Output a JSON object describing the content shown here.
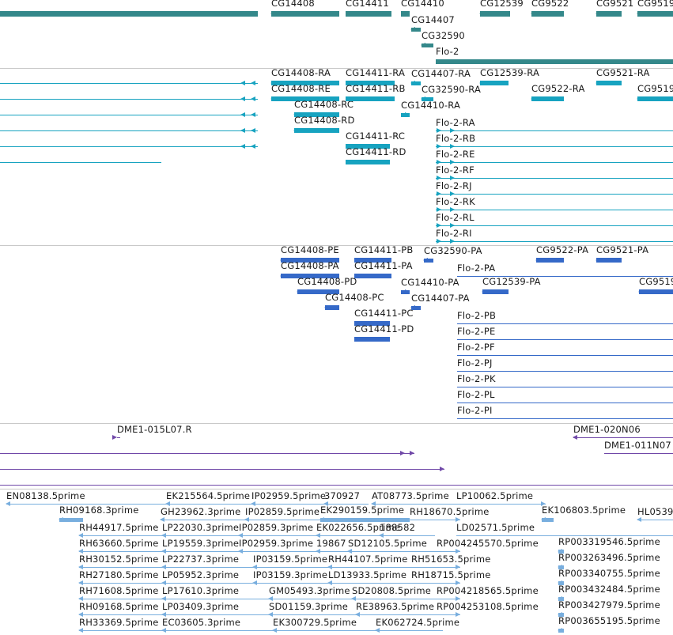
{
  "colors": {
    "gene": "#34888a",
    "transcript": "#17a3c0",
    "protein": "#3569c8",
    "clone": "#7048a8",
    "est": "#78aede",
    "separator": "#c9c9c9"
  },
  "tracks": [
    {
      "name": "gene",
      "color": "gene",
      "items": [
        [
          "",
          -20,
          326,
          17,
          7,
          "r"
        ],
        [
          "CG14408",
          343,
          429,
          17,
          7,
          "l"
        ],
        [
          "CG14411",
          437,
          495,
          17,
          7,
          "r"
        ],
        [
          "CG14410",
          507,
          518,
          17,
          7,
          "r"
        ],
        [
          "CG14407",
          520,
          532,
          37,
          5,
          "l"
        ],
        [
          "CG32590",
          533,
          548,
          57,
          5,
          "l"
        ],
        [
          "Flo-2",
          551,
          860,
          78,
          6,
          "r"
        ],
        [
          "CG12539",
          607,
          645,
          17,
          7,
          "l"
        ],
        [
          "CG9522",
          672,
          713,
          17,
          7,
          "l"
        ],
        [
          "CG9521",
          754,
          786,
          17,
          7,
          "l"
        ],
        [
          "CG9519",
          806,
          860,
          17,
          7,
          "l"
        ]
      ]
    },
    {
      "name": "transcript",
      "color": "transcript",
      "items": [
        [
          "",
          -20,
          326,
          105,
          1,
          "l",
          [
            318,
            305
          ]
        ],
        [
          "",
          -20,
          326,
          125,
          1,
          "l",
          [
            318,
            305
          ]
        ],
        [
          "",
          -20,
          326,
          145,
          1,
          "l",
          [
            318,
            305
          ]
        ],
        [
          "",
          -20,
          326,
          165,
          1,
          "l",
          [
            318,
            305
          ]
        ],
        [
          "",
          -20,
          326,
          185,
          1,
          "l",
          [
            318,
            305
          ]
        ],
        [
          "",
          -20,
          204,
          205,
          1,
          "l"
        ],
        [
          "CG14408-RA",
          343,
          429,
          105,
          6,
          "l"
        ],
        [
          "CG14408-RE",
          343,
          429,
          125,
          6,
          "l"
        ],
        [
          "CG14408-RC",
          372,
          429,
          145,
          6,
          "l"
        ],
        [
          "CG14408-RD",
          372,
          429,
          165,
          6,
          "l"
        ],
        [
          "CG14411-RA",
          437,
          499,
          105,
          6,
          "r"
        ],
        [
          "CG14411-RB",
          437,
          499,
          125,
          6,
          "r"
        ],
        [
          "CG14411-RC",
          437,
          493,
          185,
          6,
          "r"
        ],
        [
          "CG14411-RD",
          437,
          493,
          205,
          6,
          "r"
        ],
        [
          "CG14407-RA",
          520,
          532,
          105,
          5,
          "l"
        ],
        [
          "CG32590-RA",
          533,
          548,
          125,
          5,
          "l"
        ],
        [
          "CG14410-RA",
          507,
          518,
          145,
          5,
          "r"
        ],
        [
          "CG12539-RA",
          607,
          643,
          105,
          6,
          "l"
        ],
        [
          "CG9522-RA",
          672,
          713,
          125,
          6,
          "l"
        ],
        [
          "CG9521-RA",
          754,
          786,
          105,
          6,
          "l"
        ],
        [
          "CG9519",
          806,
          860,
          125,
          6,
          "l"
        ],
        [
          "Flo-2-RA",
          551,
          860,
          165,
          1,
          "r",
          [
            558,
            575
          ]
        ],
        [
          "Flo-2-RB",
          551,
          860,
          185,
          1,
          "r",
          [
            558,
            575
          ]
        ],
        [
          "Flo-2-RE",
          551,
          860,
          205,
          1,
          "r",
          [
            558,
            575
          ]
        ],
        [
          "Flo-2-RF",
          551,
          860,
          225,
          1,
          "r",
          [
            558,
            575
          ]
        ],
        [
          "Flo-2-RJ",
          551,
          860,
          245,
          1,
          "r",
          [
            558,
            575
          ]
        ],
        [
          "Flo-2-RK",
          551,
          860,
          265,
          1,
          "r",
          [
            558,
            575
          ]
        ],
        [
          "Flo-2-RL",
          551,
          860,
          285,
          1,
          "r",
          [
            558,
            575
          ]
        ],
        [
          "Flo-2-RI",
          551,
          860,
          305,
          1,
          "r",
          [
            558,
            575
          ]
        ]
      ]
    },
    {
      "name": "protein",
      "color": "protein",
      "items": [
        [
          "CG14408-PE",
          355,
          429,
          329,
          6,
          "l"
        ],
        [
          "CG14408-PA",
          355,
          429,
          349,
          6,
          "l"
        ],
        [
          "CG14408-PD",
          376,
          429,
          369,
          6,
          "l"
        ],
        [
          "CG14408-PC",
          411,
          429,
          389,
          6,
          "l"
        ],
        [
          "CG14411-PB",
          448,
          495,
          329,
          6,
          "r"
        ],
        [
          "CG14411-PA",
          448,
          495,
          349,
          6,
          "r"
        ],
        [
          "CG14411-PC",
          448,
          493,
          409,
          6,
          "r"
        ],
        [
          "CG14411-PD",
          448,
          493,
          429,
          6,
          "r"
        ],
        [
          "CG32590-PA",
          536,
          548,
          329,
          5,
          "l"
        ],
        [
          "Flo-2-PA",
          578,
          860,
          349,
          1,
          "r"
        ],
        [
          "CG14410-PA",
          507,
          518,
          369,
          5,
          "r"
        ],
        [
          "CG14407-PA",
          520,
          532,
          389,
          5,
          "l"
        ],
        [
          "CG12539-PA",
          610,
          643,
          369,
          6,
          "l"
        ],
        [
          "CG9522-PA",
          678,
          713,
          329,
          6,
          "l"
        ],
        [
          "CG9521-PA",
          754,
          786,
          329,
          6,
          "l"
        ],
        [
          "CG9519",
          808,
          860,
          369,
          6,
          "l"
        ],
        [
          "Flo-2-PB",
          578,
          860,
          409,
          1,
          "r"
        ],
        [
          "Flo-2-PE",
          578,
          860,
          429,
          1,
          "r"
        ],
        [
          "Flo-2-PF",
          578,
          860,
          449,
          1,
          "r"
        ],
        [
          "Flo-2-PJ",
          578,
          860,
          469,
          1,
          "r"
        ],
        [
          "Flo-2-PK",
          578,
          860,
          489,
          1,
          "r"
        ],
        [
          "Flo-2-PL",
          578,
          860,
          509,
          1,
          "r"
        ],
        [
          "Flo-2-PI",
          578,
          860,
          529,
          1,
          "r"
        ]
      ]
    },
    {
      "name": "clone",
      "color": "clone",
      "items": [
        [
          "DME1-015L07.R",
          148,
          152,
          553,
          1,
          "r"
        ],
        [
          "",
          -20,
          524,
          573,
          1,
          "r",
          [
            512
          ]
        ],
        [
          "",
          -20,
          562,
          593,
          1,
          "r"
        ],
        [
          "",
          -20,
          860,
          613,
          1,
          "r"
        ],
        [
          "DME1-020N06",
          725,
          860,
          553,
          1,
          "l"
        ],
        [
          "DME1-011N07",
          764,
          860,
          573,
          1,
          "r"
        ]
      ]
    },
    {
      "name": "est",
      "color": "est",
      "items": [
        [
          "EN08138.5prime",
          8,
          210,
          637,
          1,
          "l"
        ],
        [
          "EK215564.5prime",
          210,
          318,
          637,
          1,
          "l"
        ],
        [
          "IP02959.5prime",
          318,
          410,
          637,
          1,
          "l"
        ],
        [
          "370927",
          410,
          466,
          637,
          1,
          "l"
        ],
        [
          "AT08773.5prime",
          470,
          577,
          637,
          1,
          "l"
        ],
        [
          "LP10062.5prime",
          577,
          690,
          637,
          1,
          "r"
        ],
        [
          "RH09168.3prime",
          75,
          105,
          657,
          5,
          "l"
        ],
        [
          "GH23962.3prime",
          203,
          310,
          657,
          1,
          "l"
        ],
        [
          "IP02859.5prime",
          310,
          405,
          657,
          1,
          "l"
        ],
        [
          "EK290159.5prime",
          405,
          518,
          657,
          5,
          "l"
        ],
        [
          "RH18670.5prime",
          518,
          582,
          657,
          1,
          "r"
        ],
        [
          "EK106803.5prime",
          685,
          700,
          657,
          5,
          "l"
        ],
        [
          "HL0539",
          806,
          860,
          657,
          1,
          "l"
        ],
        [
          "RH44917.5prime",
          100,
          205,
          677,
          1,
          "l"
        ],
        [
          "LP22030.3prime",
          205,
          302,
          677,
          1,
          "l"
        ],
        [
          "IP02859.3prime",
          302,
          400,
          677,
          1,
          "l"
        ],
        [
          "EK022656.5prime",
          400,
          480,
          677,
          1,
          "l"
        ],
        [
          "188582",
          480,
          550,
          677,
          1,
          "l"
        ],
        [
          "LD02571.5prime",
          577,
          860,
          677,
          1,
          "r"
        ],
        [
          "RH63660.5prime",
          100,
          205,
          697,
          1,
          "l"
        ],
        [
          "LP19559.3prime",
          205,
          302,
          697,
          1,
          "l"
        ],
        [
          "IP02959.3prime",
          302,
          400,
          697,
          1,
          "l"
        ],
        [
          "19867",
          400,
          440,
          697,
          1,
          "l"
        ],
        [
          "SD12105.5prime",
          440,
          552,
          697,
          1,
          "l"
        ],
        [
          "RP004245570.5prime",
          552,
          582,
          697,
          1,
          "r"
        ],
        [
          "RP003319546.5prime",
          706,
          713,
          697,
          5,
          "l"
        ],
        [
          "RH30152.5prime",
          100,
          205,
          717,
          1,
          "l"
        ],
        [
          "LP22737.3prime",
          205,
          320,
          717,
          1,
          "l"
        ],
        [
          "IP03159.5prime",
          320,
          415,
          717,
          1,
          "l"
        ],
        [
          "RH44107.5prime",
          415,
          520,
          717,
          1,
          "l"
        ],
        [
          "RH51653.5prime",
          520,
          582,
          717,
          1,
          "r"
        ],
        [
          "RP003263496.5prime",
          706,
          713,
          717,
          5,
          "l"
        ],
        [
          "RH27180.5prime",
          100,
          205,
          737,
          1,
          "l"
        ],
        [
          "LP05952.3prime",
          205,
          320,
          737,
          1,
          "l"
        ],
        [
          "IP03159.3prime",
          320,
          415,
          737,
          1,
          "l"
        ],
        [
          "LD13933.5prime",
          415,
          520,
          737,
          1,
          "l"
        ],
        [
          "RH18715.5prime",
          520,
          582,
          737,
          1,
          "r"
        ],
        [
          "RP003340755.5prime",
          706,
          713,
          737,
          5,
          "l"
        ],
        [
          "RH71608.5prime",
          100,
          205,
          757,
          1,
          "l"
        ],
        [
          "LP17610.3prime",
          205,
          340,
          757,
          1,
          "l"
        ],
        [
          "GM05493.3prime",
          340,
          445,
          757,
          1,
          "l"
        ],
        [
          "SD20808.5prime",
          445,
          552,
          757,
          1,
          "l"
        ],
        [
          "RP004218565.5prime",
          552,
          582,
          757,
          1,
          "r"
        ],
        [
          "RP003432484.5prime",
          706,
          713,
          757,
          5,
          "l"
        ],
        [
          "RH09168.5prime",
          100,
          205,
          777,
          1,
          "l"
        ],
        [
          "LP03409.3prime",
          205,
          340,
          777,
          1,
          "l"
        ],
        [
          "SD01159.3prime",
          340,
          450,
          777,
          1,
          "l"
        ],
        [
          "RE38963.5prime",
          450,
          552,
          777,
          1,
          "l"
        ],
        [
          "RP004253108.5prime",
          552,
          582,
          777,
          1,
          "r"
        ],
        [
          "RP003427979.5prime",
          706,
          713,
          777,
          5,
          "l"
        ],
        [
          "RH33369.5prime",
          100,
          205,
          797,
          1,
          "l"
        ],
        [
          "EC03605.3prime",
          205,
          345,
          797,
          1,
          "l"
        ],
        [
          "EK300729.5prime",
          345,
          475,
          797,
          1,
          "l"
        ],
        [
          "EK062724.5prime",
          475,
          560,
          797,
          1,
          "l"
        ],
        [
          "RP003655195.5prime",
          706,
          713,
          797,
          5,
          "l"
        ]
      ]
    }
  ],
  "separators": [
    86,
    310,
    535,
    618
  ]
}
